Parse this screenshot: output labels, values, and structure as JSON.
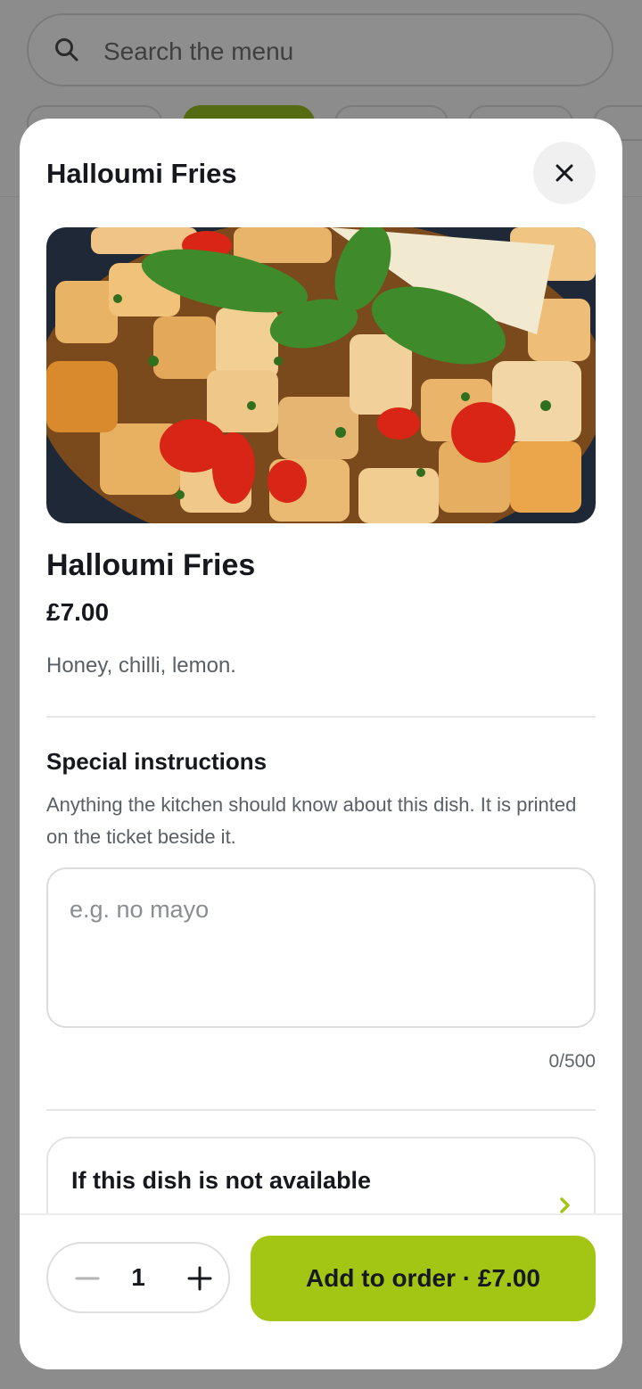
{
  "background": {
    "search": {
      "placeholder": "Search the menu",
      "icon": "search-icon"
    }
  },
  "modal": {
    "title": "Halloumi Fries",
    "close_icon": "close-icon",
    "item": {
      "name": "Halloumi Fries",
      "price": "£7.00",
      "description": "Honey, chilli, lemon."
    },
    "special_instructions": {
      "title": "Special instructions",
      "help": "Anything the kitchen should know about this dish. It is printed on the ticket beside it.",
      "placeholder": "e.g. no mayo",
      "value": "",
      "counter": "0/500"
    },
    "unavailable": {
      "title": "If this dish is not available",
      "chevron_icon": "chevron-right-icon"
    },
    "footer": {
      "quantity": "1",
      "minus_icon": "minus-icon",
      "plus_icon": "plus-icon",
      "add_label": "Add to order · £7.00"
    }
  },
  "colors": {
    "accent": "#a3c614",
    "overlay": "#8a8a8a",
    "text": "#16181d",
    "muted": "#5a5f66"
  }
}
